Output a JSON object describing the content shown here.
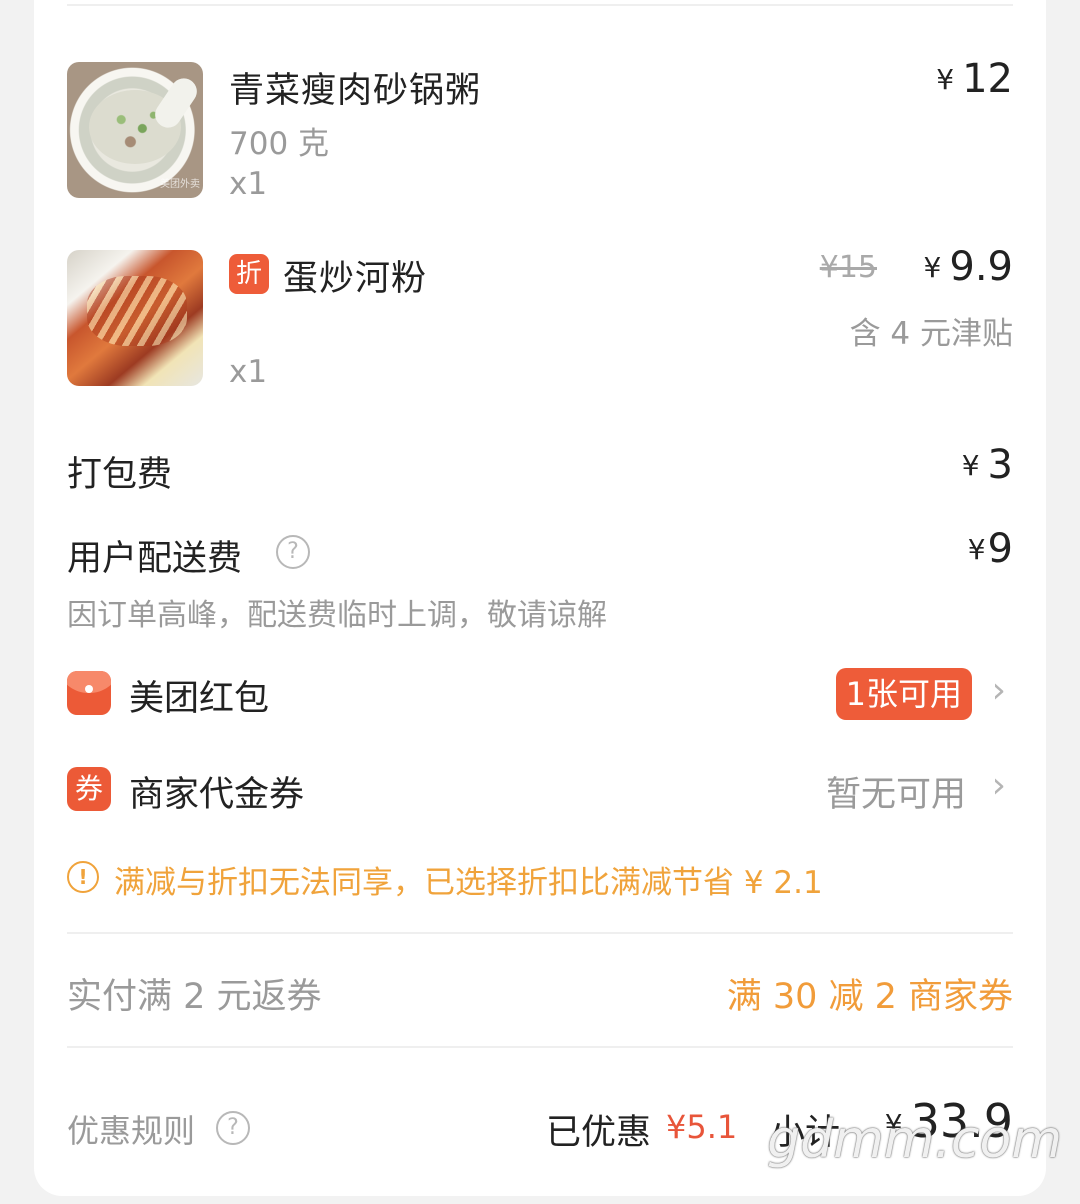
{
  "items": [
    {
      "name": "青菜瘦肉砂锅粥",
      "spec": "700 克",
      "qty": "x1",
      "currency": "¥",
      "price": "12"
    },
    {
      "discount_badge": "折",
      "name": "蛋炒河粉",
      "qty": "x1",
      "currency": "¥",
      "original_price": "¥15",
      "price": "9.9",
      "subsidy_note": "含 4 元津贴"
    }
  ],
  "fees": {
    "packing_label": "打包费",
    "packing_currency": "¥",
    "packing_amount": "3",
    "delivery_label": "用户配送费",
    "delivery_help": "?",
    "delivery_currency": "¥",
    "delivery_amount": "9",
    "delivery_note": "因订单高峰，配送费临时上调，敬请谅解"
  },
  "coupons": {
    "redpack_label": "美团红包",
    "redpack_badge": "1张可用",
    "merchant_icon": "券",
    "merchant_label": "商家代金券",
    "merchant_status": "暂无可用",
    "chevron": "›"
  },
  "warning": {
    "icon": "!",
    "text": "满减与折扣无法同享，已选择折扣比满减节省 ¥ 2.1"
  },
  "return_coupon": {
    "label": "实付满 2 元返券",
    "value": "满 30 减 2 商家券"
  },
  "summary": {
    "rules_label": "优惠规则",
    "rules_help": "?",
    "saved_label": "已优惠",
    "saved_amount": "¥5.1",
    "subtotal_label": "小计",
    "subtotal_currency": "¥",
    "subtotal_amount": "33.9"
  },
  "thumb_watermark": "美团外卖",
  "overlay_watermark": "gdmm.com",
  "colors": {
    "accent_red": "#ee5c39",
    "warning_orange": "#f0a33b",
    "muted_text": "#9a9a9a"
  }
}
